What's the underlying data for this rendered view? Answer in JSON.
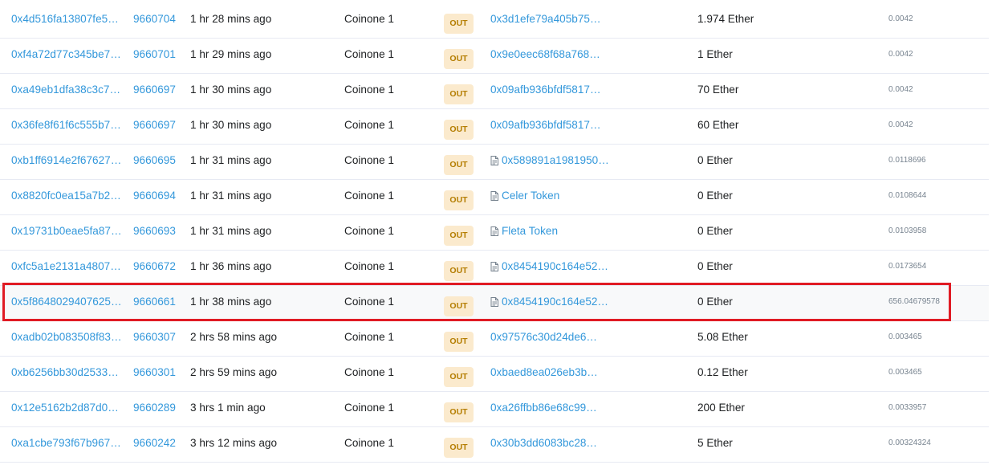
{
  "rows": [
    {
      "hash": "0x4d516fa13807fe5…",
      "block": "9660704",
      "age": "1 hr 28 mins ago",
      "from": "Coinone 1",
      "direction": "OUT",
      "to": "0x3d1efe79a405b75…",
      "to_is_contract": false,
      "value": "1.974 Ether",
      "fee": "0.0042"
    },
    {
      "hash": "0xf4a72d77c345be7…",
      "block": "9660701",
      "age": "1 hr 29 mins ago",
      "from": "Coinone 1",
      "direction": "OUT",
      "to": "0x9e0eec68f68a768…",
      "to_is_contract": false,
      "value": "1 Ether",
      "fee": "0.0042"
    },
    {
      "hash": "0xa49eb1dfa38c3c7…",
      "block": "9660697",
      "age": "1 hr 30 mins ago",
      "from": "Coinone 1",
      "direction": "OUT",
      "to": "0x09afb936bfdf5817…",
      "to_is_contract": false,
      "value": "70 Ether",
      "fee": "0.0042"
    },
    {
      "hash": "0x36fe8f61f6c555b7…",
      "block": "9660697",
      "age": "1 hr 30 mins ago",
      "from": "Coinone 1",
      "direction": "OUT",
      "to": "0x09afb936bfdf5817…",
      "to_is_contract": false,
      "value": "60 Ether",
      "fee": "0.0042"
    },
    {
      "hash": "0xb1ff6914e2f67627…",
      "block": "9660695",
      "age": "1 hr 31 mins ago",
      "from": "Coinone 1",
      "direction": "OUT",
      "to": "0x589891a1981950…",
      "to_is_contract": true,
      "value": "0 Ether",
      "fee": "0.0118696"
    },
    {
      "hash": "0x8820fc0ea15a7b2…",
      "block": "9660694",
      "age": "1 hr 31 mins ago",
      "from": "Coinone 1",
      "direction": "OUT",
      "to": "Celer Token",
      "to_is_contract": true,
      "value": "0 Ether",
      "fee": "0.0108644"
    },
    {
      "hash": "0x19731b0eae5fa87…",
      "block": "9660693",
      "age": "1 hr 31 mins ago",
      "from": "Coinone 1",
      "direction": "OUT",
      "to": "Fleta Token",
      "to_is_contract": true,
      "value": "0 Ether",
      "fee": "0.0103958"
    },
    {
      "hash": "0xfc5a1e2131a4807…",
      "block": "9660672",
      "age": "1 hr 36 mins ago",
      "from": "Coinone 1",
      "direction": "OUT",
      "to": "0x8454190c164e52…",
      "to_is_contract": true,
      "value": "0 Ether",
      "fee": "0.0173654"
    },
    {
      "hash": "0x5f8648029407625…",
      "block": "9660661",
      "age": "1 hr 38 mins ago",
      "from": "Coinone 1",
      "direction": "OUT",
      "to": "0x8454190c164e52…",
      "to_is_contract": true,
      "value": "0 Ether",
      "fee": "656.04679578"
    },
    {
      "hash": "0xadb02b083508f83…",
      "block": "9660307",
      "age": "2 hrs 58 mins ago",
      "from": "Coinone 1",
      "direction": "OUT",
      "to": "0x97576c30d24de6…",
      "to_is_contract": false,
      "value": "5.08 Ether",
      "fee": "0.003465"
    },
    {
      "hash": "0xb6256bb30d2533…",
      "block": "9660301",
      "age": "2 hrs 59 mins ago",
      "from": "Coinone 1",
      "direction": "OUT",
      "to": "0xbaed8ea026eb3b…",
      "to_is_contract": false,
      "value": "0.12 Ether",
      "fee": "0.003465"
    },
    {
      "hash": "0x12e5162b2d87d0…",
      "block": "9660289",
      "age": "3 hrs 1 min ago",
      "from": "Coinone 1",
      "direction": "OUT",
      "to": "0xa26ffbb86e68c99…",
      "to_is_contract": false,
      "value": "200 Ether",
      "fee": "0.0033957"
    },
    {
      "hash": "0xa1cbe793f67b967…",
      "block": "9660242",
      "age": "3 hrs 12 mins ago",
      "from": "Coinone 1",
      "direction": "OUT",
      "to": "0x30b3dd6083bc28…",
      "to_is_contract": false,
      "value": "5 Ether",
      "fee": "0.00324324"
    }
  ],
  "highlighted_row": 8,
  "colors": {
    "link": "#3498db",
    "badge_bg": "#fbeacd",
    "badge_text": "#b47d00",
    "highlight_border": "#e01b24"
  }
}
